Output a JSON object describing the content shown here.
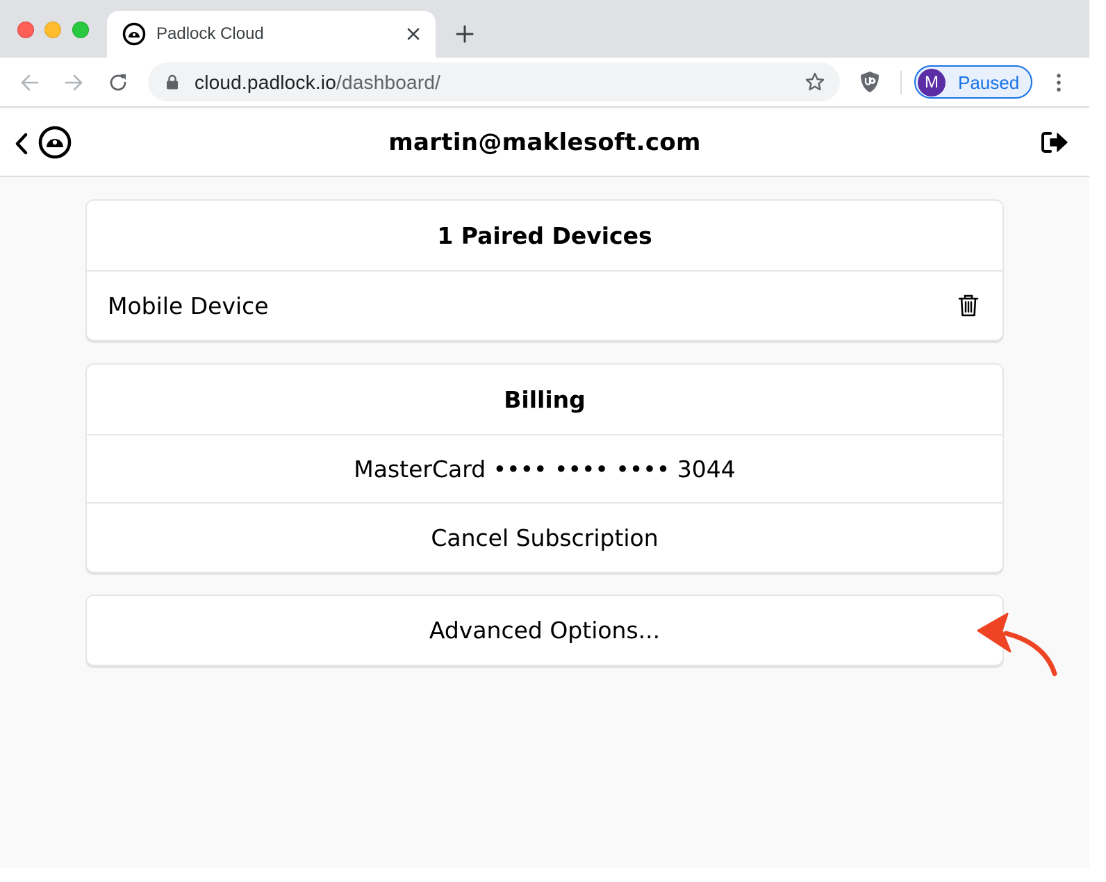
{
  "browser": {
    "tab": {
      "title": "Padlock Cloud"
    },
    "address_bar": {
      "host": "cloud.padlock.io",
      "path": "/dashboard/"
    },
    "profile": {
      "initial": "M",
      "status": "Paused"
    }
  },
  "app": {
    "header": {
      "title": "martin@maklesoft.com"
    },
    "devices_card": {
      "heading": "1 Paired Devices",
      "devices": [
        {
          "name": "Mobile Device"
        }
      ]
    },
    "billing_card": {
      "heading": "Billing",
      "card_info": "MasterCard •••• •••• •••• 3044",
      "cancel_label": "Cancel Subscription"
    },
    "advanced_card": {
      "label": "Advanced Options..."
    }
  },
  "colors": {
    "accent_blue": "#1a73e8",
    "avatar_purple": "#5b2ea6",
    "annotation_arrow": "#ee4423"
  },
  "icons": [
    "back-arrow-icon",
    "forward-arrow-icon",
    "reload-icon",
    "lock-icon",
    "star-icon",
    "ublock-icon",
    "more-vert-icon",
    "chevron-left-icon",
    "padlock-logo-icon",
    "logout-icon",
    "trash-icon",
    "close-icon",
    "plus-icon"
  ]
}
